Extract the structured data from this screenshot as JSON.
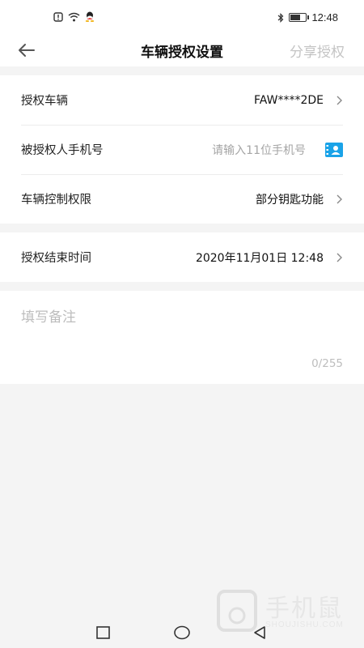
{
  "status_bar": {
    "time": "12:48",
    "battery_level": 0.7,
    "icons": [
      "alert-icon",
      "wifi-icon",
      "qq-icon",
      "bluetooth-icon",
      "battery-icon"
    ]
  },
  "header": {
    "title": "车辆授权设置",
    "share_label": "分享授权"
  },
  "form": {
    "vehicle": {
      "label": "授权车辆",
      "value": "FAW****2DE"
    },
    "phone": {
      "label": "被授权人手机号",
      "placeholder": "请输入11位手机号"
    },
    "permission": {
      "label": "车辆控制权限",
      "value": "部分钥匙功能"
    },
    "end_time": {
      "label": "授权结束时间",
      "value": "2020年11月01日 12:48"
    }
  },
  "remarks": {
    "placeholder": "填写备注",
    "counter": "0/255"
  },
  "watermark": {
    "text": "手机鼠",
    "sub": "SHOUJISHU.COM"
  },
  "colors": {
    "accent": "#1aa3e8",
    "placeholder": "#a5a5a5",
    "disabled": "#c4c4c4",
    "background": "#f4f4f4"
  }
}
